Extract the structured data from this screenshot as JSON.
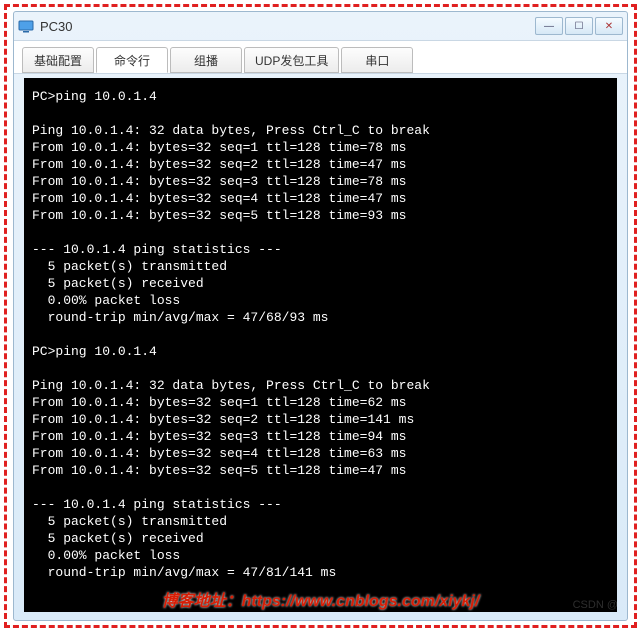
{
  "window": {
    "title": "PC30"
  },
  "tabs": {
    "basic": "基础配置",
    "cli": "命令行",
    "multicast": "组播",
    "udp": "UDP发包工具",
    "serial": "串口"
  },
  "terminal": {
    "lines": [
      "PC>ping 10.0.1.4",
      "",
      "Ping 10.0.1.4: 32 data bytes, Press Ctrl_C to break",
      "From 10.0.1.4: bytes=32 seq=1 ttl=128 time=78 ms",
      "From 10.0.1.4: bytes=32 seq=2 ttl=128 time=47 ms",
      "From 10.0.1.4: bytes=32 seq=3 ttl=128 time=78 ms",
      "From 10.0.1.4: bytes=32 seq=4 ttl=128 time=47 ms",
      "From 10.0.1.4: bytes=32 seq=5 ttl=128 time=93 ms",
      "",
      "--- 10.0.1.4 ping statistics ---",
      "  5 packet(s) transmitted",
      "  5 packet(s) received",
      "  0.00% packet loss",
      "  round-trip min/avg/max = 47/68/93 ms",
      "",
      "PC>ping 10.0.1.4",
      "",
      "Ping 10.0.1.4: 32 data bytes, Press Ctrl_C to break",
      "From 10.0.1.4: bytes=32 seq=1 ttl=128 time=62 ms",
      "From 10.0.1.4: bytes=32 seq=2 ttl=128 time=141 ms",
      "From 10.0.1.4: bytes=32 seq=3 ttl=128 time=94 ms",
      "From 10.0.1.4: bytes=32 seq=4 ttl=128 time=63 ms",
      "From 10.0.1.4: bytes=32 seq=5 ttl=128 time=47 ms",
      "",
      "--- 10.0.1.4 ping statistics ---",
      "  5 packet(s) transmitted",
      "  5 packet(s) received",
      "  0.00% packet loss",
      "  round-trip min/avg/max = 47/81/141 ms"
    ]
  },
  "watermark": {
    "text": "博客地址：https://www.cnblogs.com/xiykj/",
    "small": "CSDN @"
  }
}
